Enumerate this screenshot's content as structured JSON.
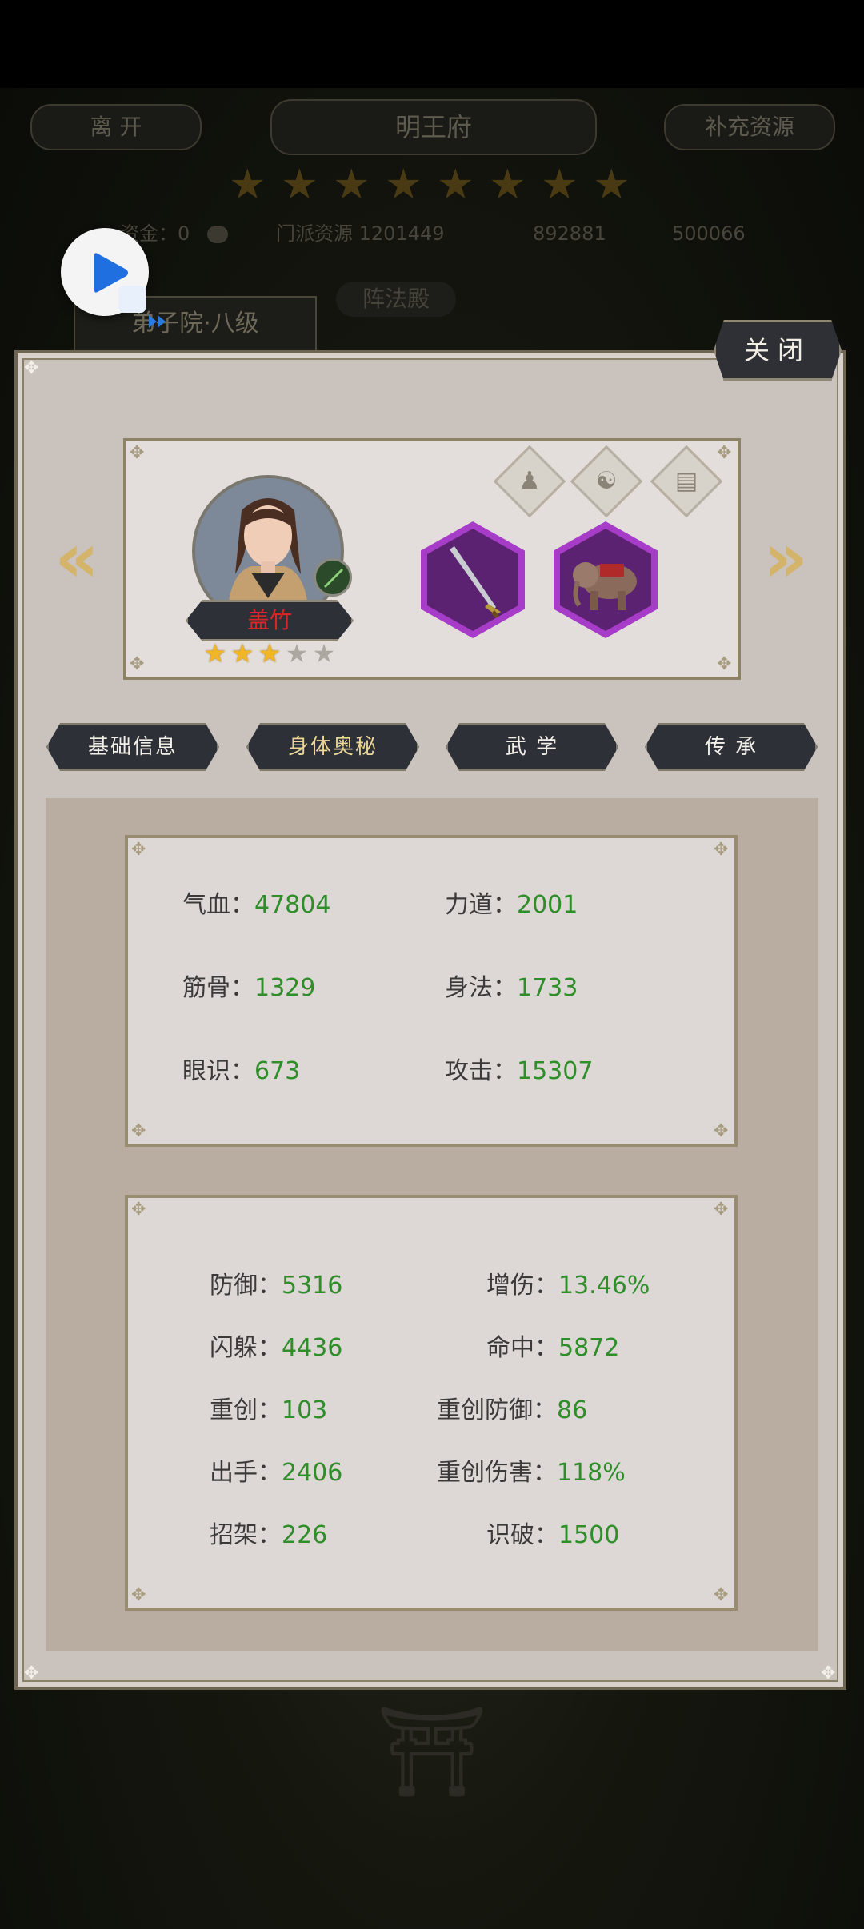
{
  "background": {
    "left_button": "离 开",
    "title": "明王府",
    "right_button": "补充资源",
    "star_count": 8,
    "resources": {
      "gold_label": "资金：",
      "gold_value": "0",
      "sect_label": "门派资源",
      "sect_value": "1201449",
      "res2_value": "892881",
      "res3_value": "500066"
    },
    "active_tab": "弟子院·八级",
    "side_tab": "阵法殿"
  },
  "panel": {
    "close_label": "关闭",
    "hero": {
      "name": "盖竹",
      "stars_filled": 3,
      "stars_total": 5,
      "equipment": [
        "sword-icon",
        "elephant-mount-icon"
      ],
      "small_icons": [
        "figure-icon",
        "yinyang-icon",
        "book-icon"
      ]
    },
    "tabs": [
      {
        "label": "基础信息",
        "active": false
      },
      {
        "label": "身体奥秘",
        "active": true
      },
      {
        "label": "武 学",
        "active": false
      },
      {
        "label": "传 承",
        "active": false
      }
    ],
    "basic_stats": [
      {
        "label": "气血：",
        "value": "47804"
      },
      {
        "label": "力道：",
        "value": "2001"
      },
      {
        "label": "筋骨：",
        "value": "1329"
      },
      {
        "label": "身法：",
        "value": "1733"
      },
      {
        "label": "眼识：",
        "value": "673"
      },
      {
        "label": "攻击：",
        "value": "15307"
      }
    ],
    "advanced_stats": [
      {
        "label": "防御：",
        "value": "5316"
      },
      {
        "label": "增伤：",
        "value": "13.46%"
      },
      {
        "label": "闪躲：",
        "value": "4436"
      },
      {
        "label": "命中：",
        "value": "5872"
      },
      {
        "label": "重创：",
        "value": "103"
      },
      {
        "label": "重创防御：",
        "value": "86"
      },
      {
        "label": "出手：",
        "value": "2406"
      },
      {
        "label": "重创伤害：",
        "value": "118%"
      },
      {
        "label": "招架：",
        "value": "226"
      },
      {
        "label": "识破：",
        "value": "1500"
      }
    ]
  },
  "colors": {
    "value_green": "#2f8d2a",
    "name_red": "#d8262a",
    "panel_bg": "#c9c2bd"
  }
}
